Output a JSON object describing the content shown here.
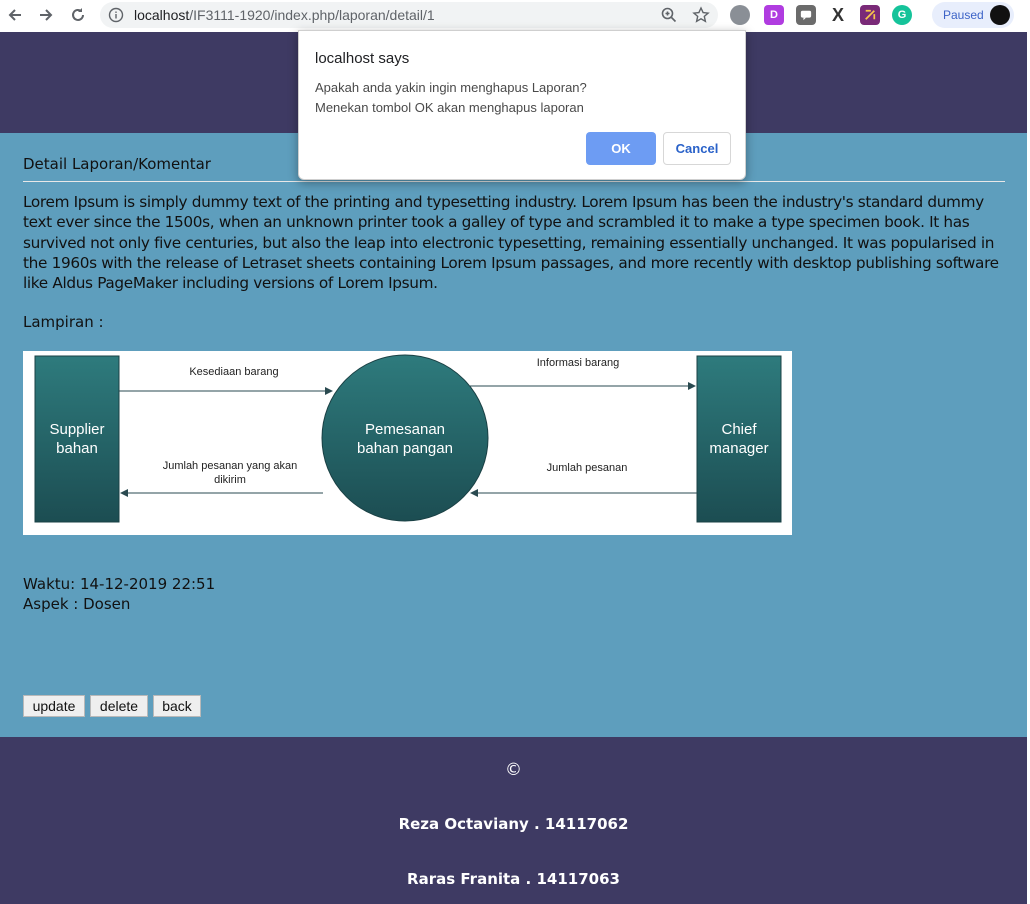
{
  "browser": {
    "url_host": "localhost",
    "url_path": "/IF3111-1920/index.php/laporan/detail/1",
    "paused_label": "Paused",
    "extensions": [
      {
        "icon": "raindrop-icon",
        "letter": "",
        "color": "#8a8f96"
      },
      {
        "icon": "d-extension-icon",
        "letter": "D",
        "color": "#b03ce0"
      },
      {
        "icon": "chat-extension-icon",
        "letter": "",
        "color": "#6b6b6b"
      },
      {
        "icon": "x-extension-icon",
        "letter": "X",
        "color": "#333333"
      },
      {
        "icon": "tab-extension-icon",
        "letter": "",
        "color": "#7a2a78"
      },
      {
        "icon": "grammarly-icon",
        "letter": "G",
        "color": "#15c39a"
      }
    ]
  },
  "dialog": {
    "title": "localhost says",
    "line1": "Apakah anda yakin ingin menghapus Laporan?",
    "line2": "Menekan tombol OK akan menghapus laporan",
    "ok_label": "OK",
    "cancel_label": "Cancel"
  },
  "main": {
    "section_title": "Detail Laporan/Komentar",
    "body": "Lorem Ipsum is simply dummy text of the printing and typesetting industry. Lorem Ipsum has been the industry's standard dummy text ever since the 1500s, when an unknown printer took a galley of type and scrambled it to make a type specimen book. It has survived not only five centuries, but also the leap into electronic typesetting, remaining essentially unchanged. It was popularised in the 1960s with the release of Letraset sheets containing Lorem Ipsum passages, and more recently with desktop publishing software like Aldus PageMaker including versions of Lorem Ipsum.",
    "lampiran_label": "Lampiran :",
    "waktu": "Waktu: 14-12-2019 22:51",
    "aspek": "Aspek : Dosen",
    "buttons": {
      "update": "update",
      "delete": "delete",
      "back": "back"
    }
  },
  "diagram": {
    "left_box": [
      "Supplier",
      "bahan"
    ],
    "center_circle": [
      "Pemesanan",
      "bahan pangan"
    ],
    "right_box": [
      "Chief",
      "manager"
    ],
    "arrow_top_left": "Kesediaan barang",
    "arrow_bottom_left": [
      "Jumlah pesanan yang akan",
      "dikirim"
    ],
    "arrow_top_right": "Informasi barang",
    "arrow_bottom_right": "Jumlah pesanan"
  },
  "footer": {
    "copyright": "©",
    "author1": "Reza Octaviany . 14117062",
    "author2": "Raras Franita . 14117063"
  }
}
